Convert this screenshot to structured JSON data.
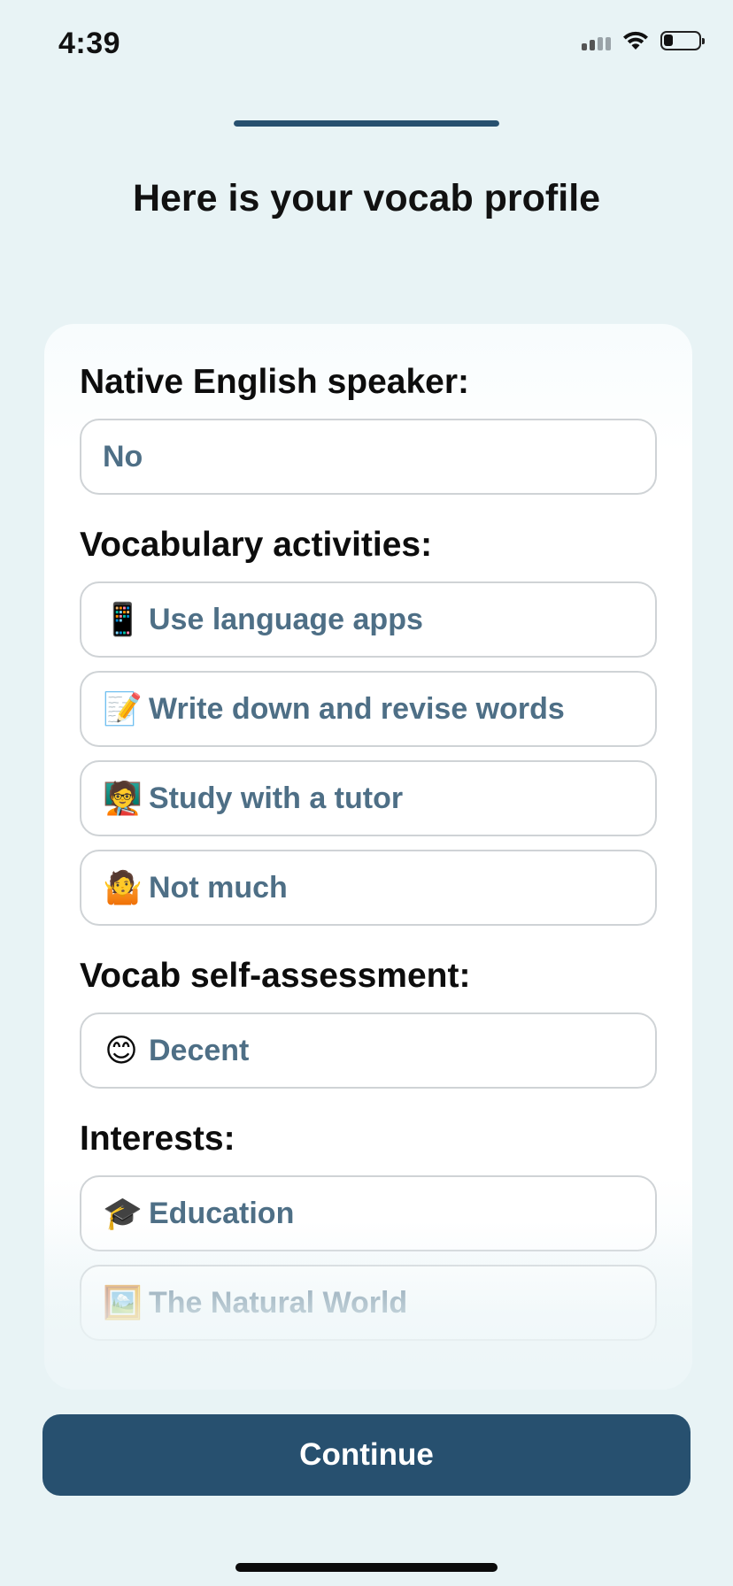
{
  "status_bar": {
    "time": "4:39",
    "icons": [
      "cellular-signal-icon",
      "wifi-icon",
      "battery-icon"
    ]
  },
  "progress": {
    "fraction": 1.0
  },
  "page": {
    "title": "Here is your vocab profile"
  },
  "profile": {
    "native_speaker": {
      "label": "Native English speaker:",
      "value": "No"
    },
    "activities": {
      "label": "Vocabulary activities:",
      "items": [
        {
          "emoji": "📱",
          "icon": "mobile-phone-icon",
          "text": "Use language apps"
        },
        {
          "emoji": "📝",
          "icon": "memo-icon",
          "text": "Write down and revise words"
        },
        {
          "emoji": "🧑‍🏫",
          "icon": "teacher-icon",
          "text": "Study with a tutor"
        },
        {
          "emoji": "🤷",
          "icon": "shrug-icon",
          "text": "Not much"
        }
      ]
    },
    "self_assessment": {
      "label": "Vocab self-assessment:",
      "emoji": "😊",
      "icon": "smiling-face-icon",
      "value": "Decent"
    },
    "interests": {
      "label": "Interests:",
      "items": [
        {
          "emoji": "🎓",
          "icon": "graduation-cap-icon",
          "text": "Education"
        },
        {
          "emoji": "🖼️",
          "icon": "framed-picture-icon",
          "text": "The Natural World"
        }
      ]
    }
  },
  "actions": {
    "continue_label": "Continue"
  },
  "colors": {
    "background": "#e8f3f5",
    "accent": "#27506f",
    "chip_text": "#4e6f86",
    "chip_border": "#cfd3d6"
  }
}
